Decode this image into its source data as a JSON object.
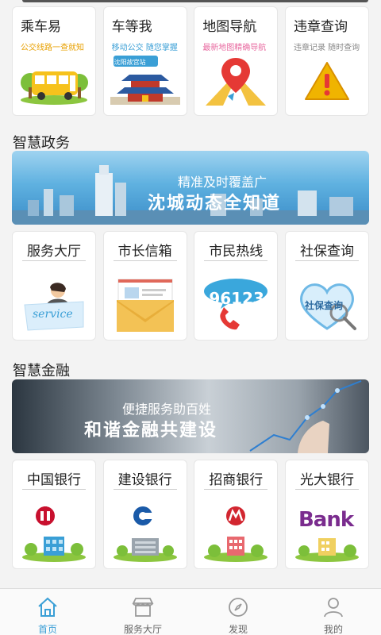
{
  "services_row1": [
    {
      "title": "乘车易",
      "sub": "公交线路一查就知",
      "sub_color": "#e8a000",
      "icon": "bus-icon"
    },
    {
      "title": "车等我",
      "sub": "移动公交  随您掌握",
      "sub_color": "#3a9fd6",
      "icon": "pagoda-icon",
      "art_label": "沈阳故宫站"
    },
    {
      "title": "地图导航",
      "sub": "最新地图精确导航",
      "sub_color": "#e86aa0",
      "icon": "map-pin-icon"
    },
    {
      "title": "违章查询",
      "sub": "违章记录 随时查询",
      "sub_color": "#888888",
      "icon": "warning-icon"
    }
  ],
  "gov": {
    "section_title": "智慧政务",
    "banner": {
      "line1": "精准及时覆盖广",
      "line2": "沈城动态全知道"
    },
    "items": [
      {
        "title": "服务大厅",
        "icon": "service-desk-icon",
        "art_label": "service"
      },
      {
        "title": "市长信箱",
        "icon": "envelope-icon"
      },
      {
        "title": "市民热线",
        "icon": "hotline-phone-icon",
        "art_label": "96123"
      },
      {
        "title": "社保查询",
        "icon": "social-security-icon",
        "art_label": "社保查询"
      }
    ]
  },
  "finance": {
    "section_title": "智慧金融",
    "banner": {
      "line1": "便捷服务助百姓",
      "line2": "和谐金融共建设"
    },
    "items": [
      {
        "title": "中国银行",
        "icon": "boc-logo-icon"
      },
      {
        "title": "建设银行",
        "icon": "ccb-logo-icon"
      },
      {
        "title": "招商银行",
        "icon": "cmb-logo-icon"
      },
      {
        "title": "光大银行",
        "icon": "bank-logo-icon",
        "art_label": "Bank"
      }
    ]
  },
  "tabbar": [
    {
      "label": "首页",
      "icon": "home-icon",
      "active": true
    },
    {
      "label": "服务大厅",
      "icon": "store-icon",
      "active": false
    },
    {
      "label": "发现",
      "icon": "compass-icon",
      "active": false
    },
    {
      "label": "我的",
      "icon": "user-icon",
      "active": false
    }
  ],
  "colors": {
    "accent": "#3a9fd6",
    "warning": "#f0b400",
    "pin": "#e53935"
  }
}
